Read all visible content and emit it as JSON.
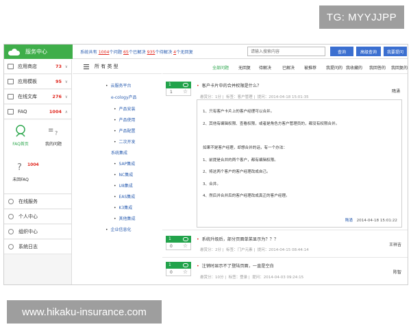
{
  "watermarks": {
    "top_right": "TG: MYYJJPP",
    "bottom_left": "www.hikaku-insurance.com"
  },
  "header": {
    "brand": "服务中心",
    "stats": {
      "prefix": "系统共有",
      "total": "1004",
      "total_suffix": "个问题",
      "solved": "65",
      "solved_suffix": "个已解决",
      "pending": "935",
      "pending_suffix": "个待解决",
      "unanswered": "4",
      "unanswered_suffix": "个无回复"
    },
    "search_placeholder": "请输入搜索内容",
    "search_button": "查询",
    "advanced_button": "高级查询",
    "ask_button": "我要提问"
  },
  "sidebar": {
    "items": [
      {
        "label": "应用商店",
        "count": "73"
      },
      {
        "label": "应用模板",
        "count": "95"
      },
      {
        "label": "在线文库",
        "count": "276"
      },
      {
        "label": "FAQ",
        "count": "1004"
      }
    ],
    "faq_tiles": [
      {
        "label": "FAQ首页"
      },
      {
        "label": "我的问题"
      },
      {
        "label": "未回FAQ",
        "count": "1004"
      }
    ],
    "links": [
      {
        "label": "在线服务"
      },
      {
        "label": "个人中心"
      },
      {
        "label": "组织中心"
      },
      {
        "label": "系统日志"
      }
    ]
  },
  "tree": {
    "header": "所 有 类 型",
    "items": [
      {
        "label": "云服务平台",
        "bullet": true
      },
      {
        "label": "e-cology产品",
        "bullet": false
      },
      {
        "label": "产品安装",
        "bullet": true
      },
      {
        "label": "产品使用",
        "bullet": true
      },
      {
        "label": "产品配置",
        "bullet": true
      },
      {
        "label": "二次开发",
        "bullet": true
      },
      {
        "label": "系统集成",
        "bullet": false
      },
      {
        "label": "SAP集成",
        "bullet": true
      },
      {
        "label": "NC集成",
        "bullet": true
      },
      {
        "label": "U8集成",
        "bullet": true
      },
      {
        "label": "EAS集成",
        "bullet": true
      },
      {
        "label": "K3集成",
        "bullet": true
      },
      {
        "label": "其他集成",
        "bullet": true
      },
      {
        "label": "企业信息化",
        "bullet": true
      }
    ]
  },
  "filters": [
    "全部问题",
    "无回复",
    "待解决",
    "已解决",
    "被推荐",
    "我提问的",
    "我收藏的",
    "我回答的",
    "我回复的"
  ],
  "questions": [
    {
      "answers": "1",
      "votes": "1",
      "title": "客户卡片中的合并权限是什么？",
      "reward": "悬赏分：1分",
      "tags": "标签：客户管理",
      "asker": "提问：2014-04-18 15:01:35",
      "author": "隋涌",
      "answer": {
        "lines": [
          "1、只有客户卡片上的客户经理可以合并。",
          "2、其他有编辑权限、查看权限，或者是角色方客户管理员的，都没有权限合并。",
          "如果不是客户经理，却想合并的话，有一个办法：",
          "1、前提是合并的两个客户，都有编辑权限。",
          "2、将这两个客户的客户经理改成自己。",
          "3、合并。",
          "4、然后并合并后的客户经理改成真正的客户经理。"
        ],
        "author": "隋涌",
        "time": "2014-04-18 15:01:22"
      }
    },
    {
      "answers": "1",
      "votes": "0",
      "title": "系统升级后，部分页面单菜显示为？？？",
      "reward": "悬赏分：2分",
      "tags": "标签：门户元素",
      "asker": "提问：2014-04-15 08:44:14",
      "author": "王祥吉"
    },
    {
      "answers": "1",
      "votes": "0",
      "title": "注销时显示不了登陆页面，一直是空白",
      "reward": "悬赏分：10分",
      "tags": "标签：登录",
      "asker": "提问：2014-04-03 09:24:15",
      "author": "陈智"
    }
  ]
}
